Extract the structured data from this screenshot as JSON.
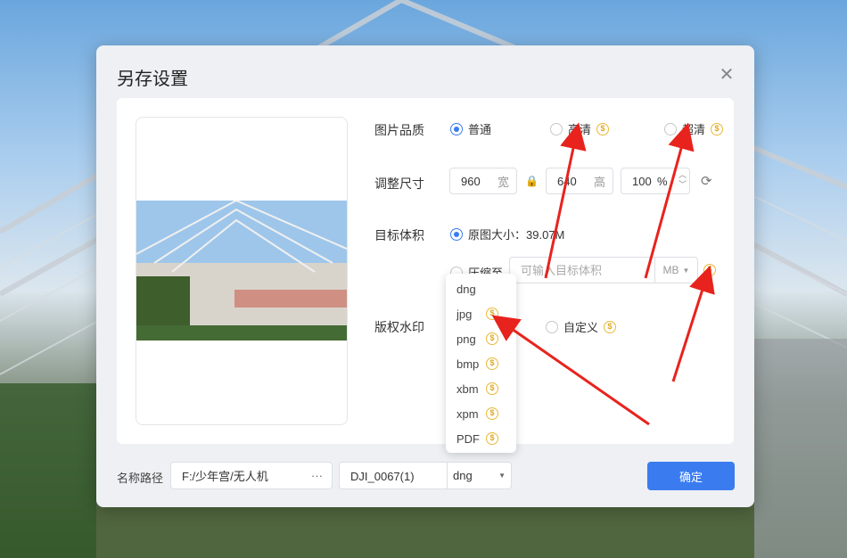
{
  "dialog": {
    "title": "另存设置",
    "close_icon": "close-icon",
    "quality": {
      "label": "图片品质",
      "options": [
        {
          "label": "普通",
          "selected": true,
          "vip": false
        },
        {
          "label": "高清",
          "selected": false,
          "vip": true
        },
        {
          "label": "超清",
          "selected": false,
          "vip": true
        }
      ]
    },
    "resize": {
      "label": "调整尺寸",
      "width_value": "960",
      "width_suffix": "宽",
      "height_value": "640",
      "height_suffix": "高",
      "percent_value": "100",
      "percent_suffix": "%"
    },
    "target": {
      "label": "目标体积",
      "original_option": "原图大小：39.07M",
      "compress_option": "压缩至",
      "placeholder": "可输入目标体积",
      "unit": "MB"
    },
    "watermark": {
      "label": "版权水印",
      "custom_option": "自定义"
    },
    "bottom": {
      "path_label": "名称路径",
      "path_value": "F:/少年宫/无人机",
      "path_more": "···",
      "file_name": "DJI_0067(1)",
      "format": "dng",
      "confirm": "确定"
    },
    "format_menu": [
      {
        "label": "dng",
        "vip": false
      },
      {
        "label": "jpg",
        "vip": true
      },
      {
        "label": "png",
        "vip": true
      },
      {
        "label": "bmp",
        "vip": true
      },
      {
        "label": "xbm",
        "vip": true
      },
      {
        "label": "xpm",
        "vip": true
      },
      {
        "label": "PDF",
        "vip": true
      }
    ],
    "vip_badge": "$"
  },
  "colors": {
    "accent": "#3a7cf0",
    "vip": "#e8b938",
    "annotation": "#e8231d"
  }
}
